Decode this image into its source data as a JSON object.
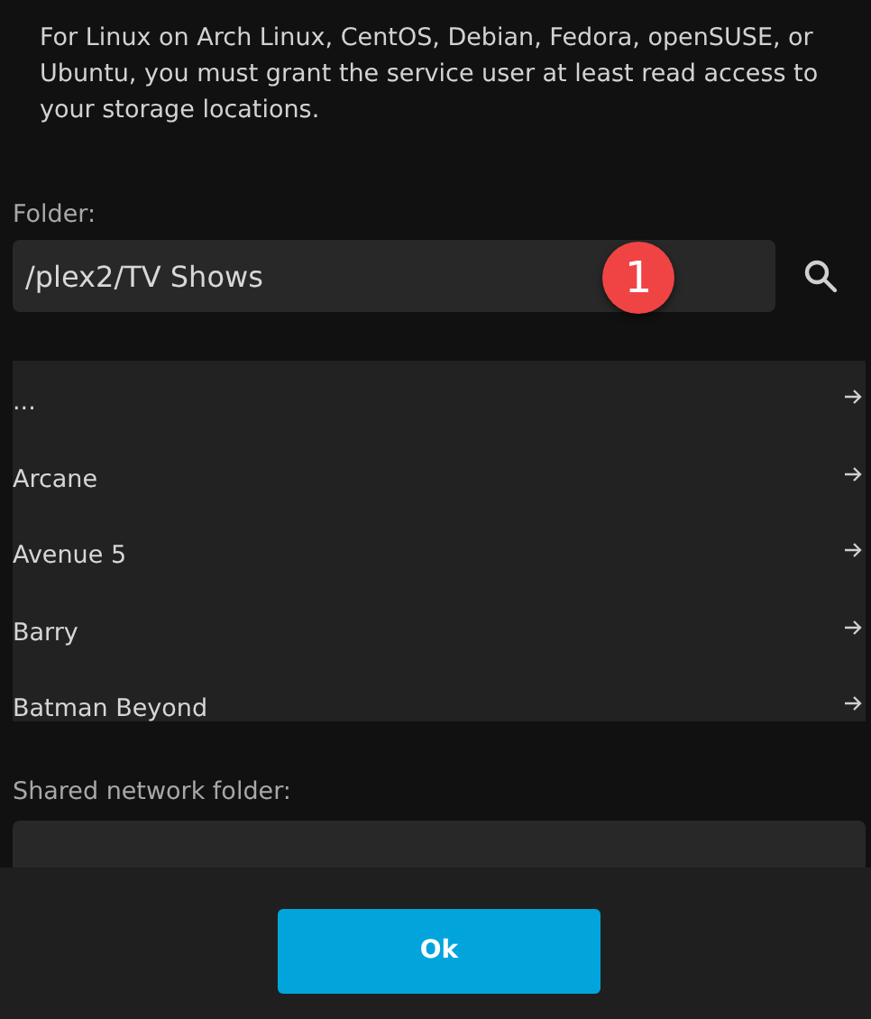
{
  "notice": "For Linux on Arch Linux, CentOS, Debian, Fedora, openSUSE, or Ubuntu, you must grant the service user at least read access to your storage locations.",
  "folder": {
    "label": "Folder:",
    "value": "/plex2/TV Shows",
    "badge": "1"
  },
  "folder_list": [
    {
      "name": "..."
    },
    {
      "name": "Arcane"
    },
    {
      "name": "Avenue 5"
    },
    {
      "name": "Barry"
    },
    {
      "name": "Batman Beyond"
    }
  ],
  "shared_network_folder": {
    "label": "Shared network folder:"
  },
  "buttons": [
    {
      "label": "Ok"
    }
  ]
}
